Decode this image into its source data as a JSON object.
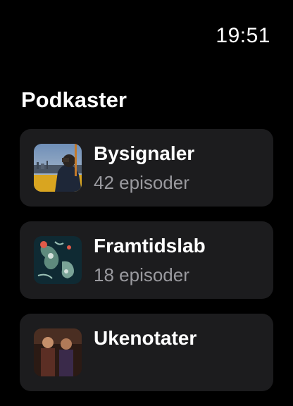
{
  "status_bar": {
    "time": "19:51"
  },
  "header": {
    "title": "Podkaster"
  },
  "podcasts": [
    {
      "title": "Bysignaler",
      "episodes": "42 episoder",
      "icon": "city-portrait-artwork"
    },
    {
      "title": "Framtidslab",
      "episodes": "18 episoder",
      "icon": "abstract-map-artwork"
    },
    {
      "title": "Ukenotater",
      "episodes": "",
      "icon": "people-scene-artwork"
    }
  ],
  "colors": {
    "background": "#000000",
    "card": "#1c1c1e",
    "secondary_text": "#9a9a9f"
  }
}
